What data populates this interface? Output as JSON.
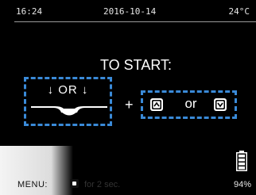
{
  "status_bar": {
    "time": "16:24",
    "date": "2016-10-14",
    "temperature": "24°C"
  },
  "prompt": {
    "title": "TO START:",
    "left_option": {
      "arrow_icon": "down-arrow-icon",
      "or_label": "OR",
      "illustration": "handlebar-icon"
    },
    "plus_label": "+",
    "right_option": {
      "up_key_icon": "up-button-icon",
      "or_label": "or",
      "down_key_icon": "down-button-icon"
    }
  },
  "footer": {
    "menu_label": "MENU:",
    "menu_key_icon": "menu-button-icon",
    "menu_duration": "for 2 sec.",
    "battery_icon": "battery-icon",
    "battery_percent": "94%"
  },
  "colors": {
    "screen_bg": "#000000",
    "accent_dashed": "#3a8ad8",
    "text": "#ffffff"
  }
}
